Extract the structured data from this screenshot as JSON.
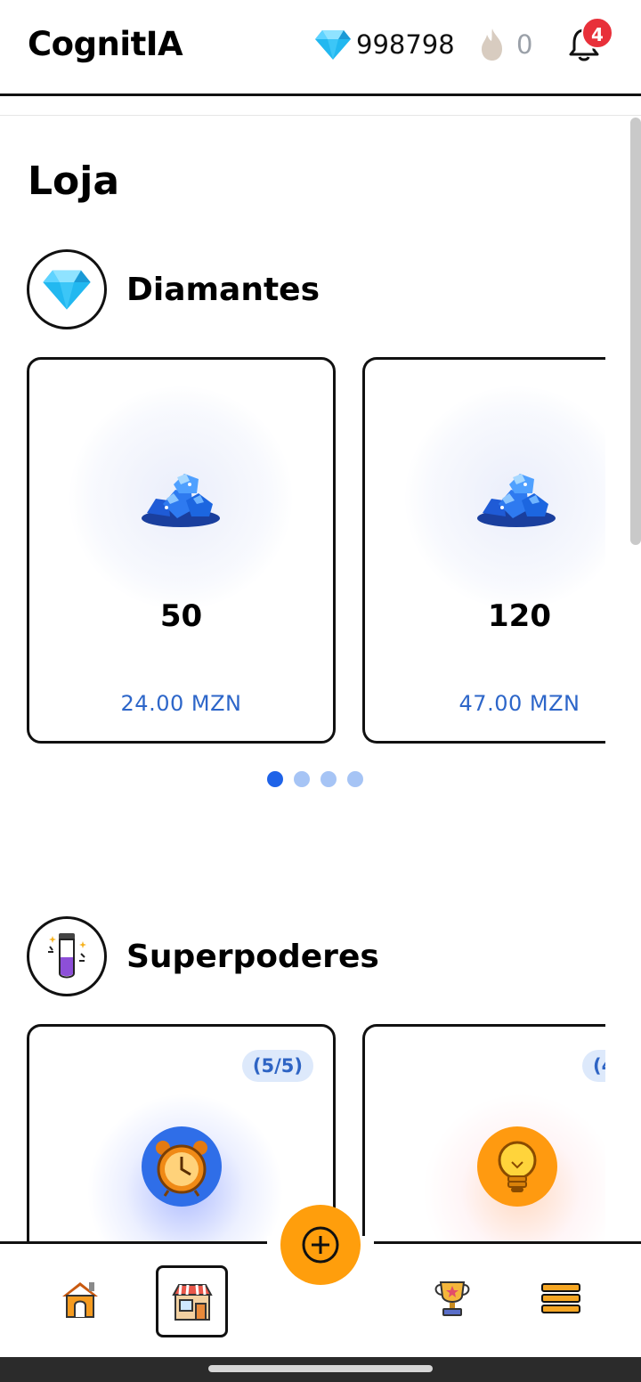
{
  "header": {
    "brand": "CognitIA",
    "gems": "998798",
    "streak": "0",
    "notifications": "4"
  },
  "page": {
    "title": "Loja"
  },
  "diamonds": {
    "title": "Diamantes",
    "packs": [
      {
        "amount": "50",
        "price": "24.00 MZN"
      },
      {
        "amount": "120",
        "price": "47.00 MZN"
      }
    ],
    "pagination": {
      "pages": 4,
      "active": 1
    }
  },
  "superpowers": {
    "title": "Superpoderes",
    "items": [
      {
        "counter": "(5/5)",
        "icon": "alarm-clock-icon",
        "color": "#2f6ee8"
      },
      {
        "counter": "(4",
        "icon": "light-bulb-icon",
        "color": "#ff8a00"
      }
    ]
  },
  "nav": {
    "items": [
      "home-icon",
      "shop-icon",
      "trophy-icon",
      "menu-icon"
    ],
    "active": "shop-icon",
    "accent": "#ff9e0c"
  }
}
